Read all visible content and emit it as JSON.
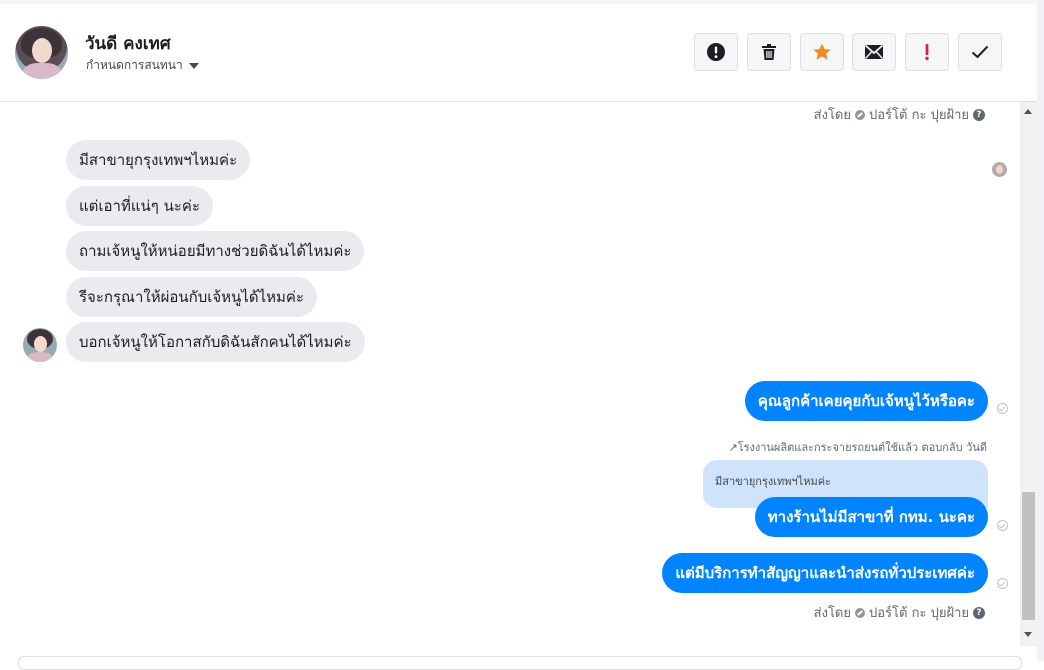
{
  "header": {
    "contact_name": "วันดี คงเทศ",
    "subtitle": "กำหนดการสนทนา",
    "toolbar": [
      {
        "name": "exclamation-circle-icon",
        "color": "#1c1e21"
      },
      {
        "name": "trash-icon",
        "color": "#1c1e21"
      },
      {
        "name": "star-icon",
        "color": "#f28b1f"
      },
      {
        "name": "envelope-icon",
        "color": "#1c1e21"
      },
      {
        "name": "exclamation-icon",
        "color": "#e41e3f"
      },
      {
        "name": "checkmark-icon",
        "color": "#1c1e21"
      }
    ]
  },
  "conversation": {
    "sent_by_top": "ส่งโดย",
    "sent_by_name_top": "ปอร์โต้ กะ ปุยฝ้าย",
    "incoming": [
      "มีสาขายุกรุงเทพฯไหมค่ะ",
      "แต่เอาที่แน่ๆ นะค่ะ",
      "ถามเจ้หนูให้หน่อยมีทางช่วยดิฉันได้ไหมค่ะ",
      "รีจะกรุณาให้ผ่อนกับเจ้หนูได้ไหมค่ะ",
      "บอกเจ้หนูให้โอกาสกับดิฉันสักคนได้ไหมค่ะ"
    ],
    "outgoing_1": "คุณลูกค้าเคยคุยกับเจ้หนูไว้หรือคะ",
    "reply_note": "โรงงานผลิตและกระจายรถยนต์ใช้แล้ว ตอบกลับ วันดี",
    "quoted_text": "มีสาขายุกรุงเทพฯไหมค่ะ",
    "outgoing_2": "ทางร้านไม่มีสาขาที่ กทม. นะคะ",
    "outgoing_3": "แต่มีบริการทำสัญญาและนำส่งรถทั่วประเทศค่ะ",
    "sent_by_bottom": "ส่งโดย",
    "sent_by_name_bottom": "ปอร์โต้ กะ ปุยฝ้าย"
  },
  "colors": {
    "outgoing_bubble": "#0084ff",
    "incoming_bubble": "#e9ebee",
    "quoted_bubble": "#cfe3fb"
  }
}
